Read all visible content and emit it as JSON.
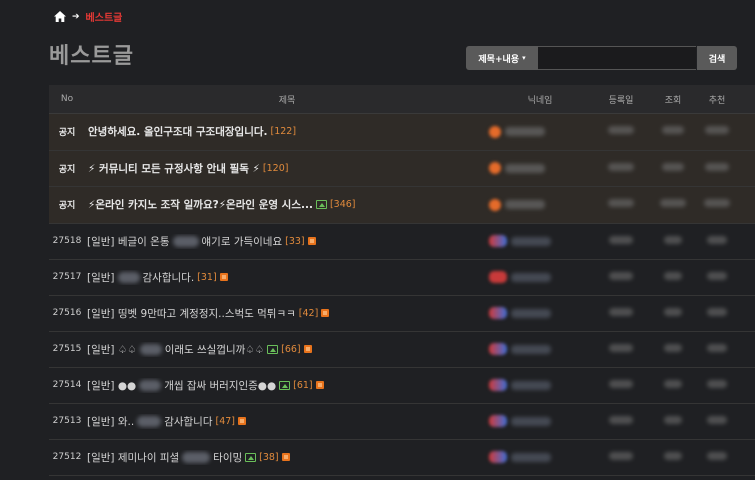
{
  "breadcrumb": {
    "current": "베스트글"
  },
  "page_title": "베스트글",
  "search": {
    "select_label": "제목+내용",
    "input_value": "",
    "button_label": "검색"
  },
  "table": {
    "headers": {
      "no": "No",
      "title": "제목",
      "nickname": "닉네임",
      "date": "등록일",
      "views": "조회",
      "recommend": "추천"
    },
    "rows": [
      {
        "no": "공지",
        "type": "notice",
        "title": "안녕하세요. 올인구조대 구조대장입니다.",
        "count": "[122]"
      },
      {
        "no": "공지",
        "type": "notice",
        "title": "⚡ 커뮤니티 모든 규정사항 안내 필독 ⚡",
        "count": "[120]"
      },
      {
        "no": "공지",
        "type": "notice",
        "title": "⚡온라인 카지노 조작 일까요?⚡온라인 운영 시스...",
        "count": "[346]",
        "has_image": true
      },
      {
        "no": "27518",
        "type": "normal",
        "title_a": "[일반] 베글이 온통",
        "title_b": "얘기로 가득이네요",
        "count": "[33]",
        "is_new": true
      },
      {
        "no": "27517",
        "type": "normal",
        "title_a": "[일반]",
        "title_b": "감사합니다.",
        "count": "[31]",
        "is_new": true
      },
      {
        "no": "27516",
        "type": "normal",
        "title_a": "[일반] 띵벳 9만따고 계정정지..스벅도 먹튀ㅋㅋ",
        "title_b": "",
        "count": "[42]",
        "is_new": true
      },
      {
        "no": "27515",
        "type": "normal",
        "title_a": "[일반] ♤♤",
        "title_b": "이래도 쓰실껍니까♤♤",
        "count": "[66]",
        "has_image": true,
        "is_new": true
      },
      {
        "no": "27514",
        "type": "normal",
        "title_a": "[일반] ●●",
        "title_b": "개씹 잡싸 버러지인증●●",
        "count": "[61]",
        "has_image": true,
        "is_new": true
      },
      {
        "no": "27513",
        "type": "normal",
        "title_a": "[일반] 와..",
        "title_b": "감사합니다",
        "count": "[47]",
        "is_new": true
      },
      {
        "no": "27512",
        "type": "normal",
        "title_a": "[일반] 제미나이 피셜",
        "title_b": "타이밍",
        "count": "[38]",
        "has_image": true,
        "is_new": true
      }
    ]
  },
  "colors": {
    "background": "#1f2023",
    "notice_row": "#2f2b27",
    "accent_red": "#e53935",
    "count_orange": "#e08a3c"
  }
}
